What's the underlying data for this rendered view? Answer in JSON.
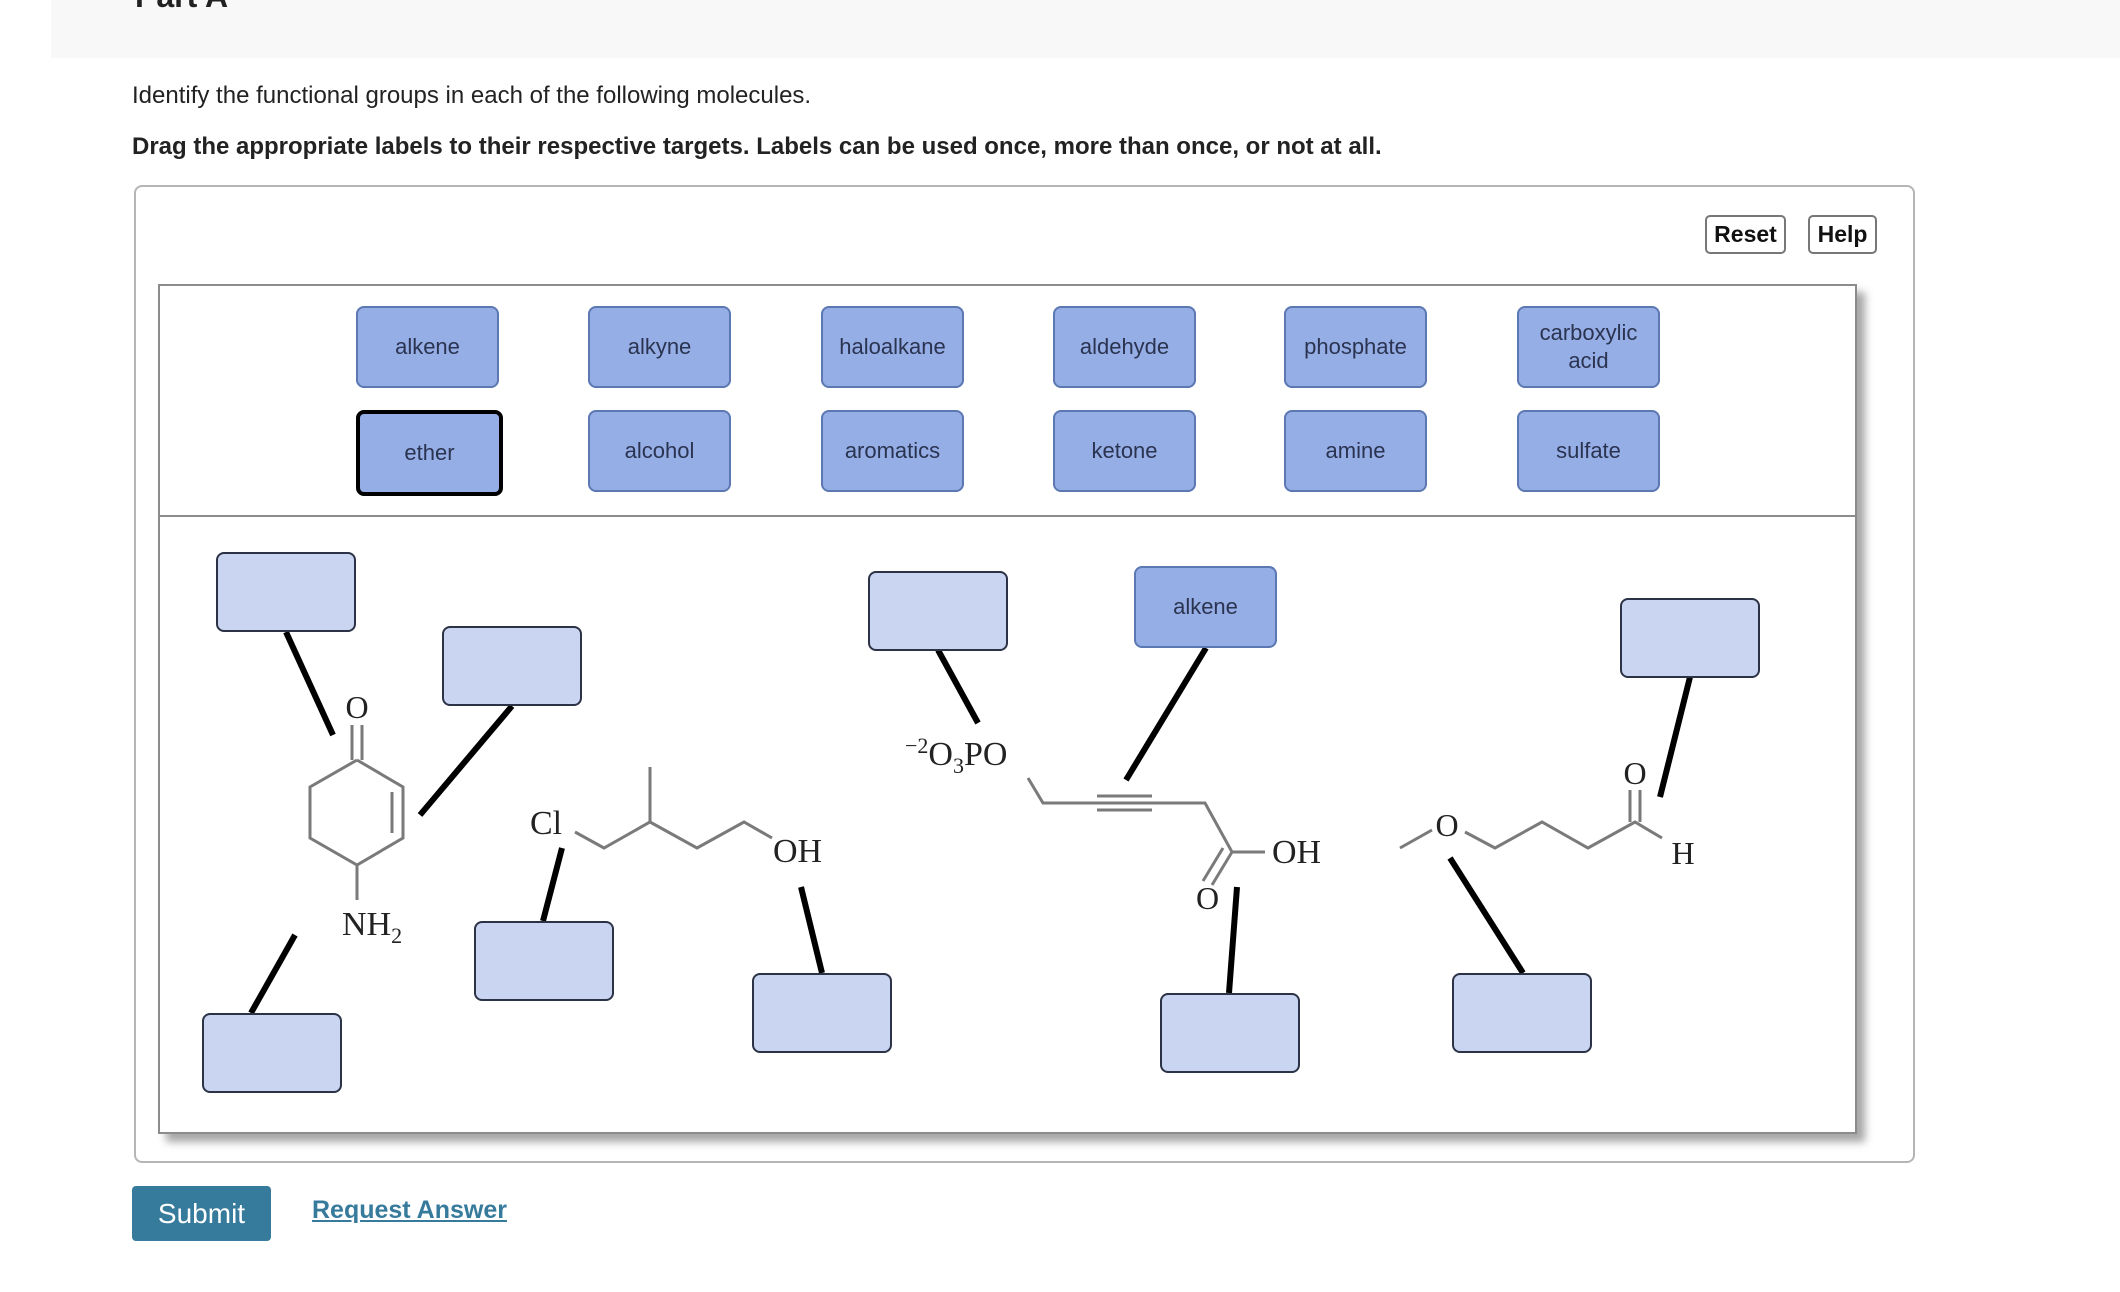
{
  "header": {
    "part_title": "Part A"
  },
  "instructions": {
    "prompt": "Identify the functional groups in each of the following molecules.",
    "directions": "Drag the appropriate labels to their respective targets. Labels can be used once, more than once, or not at all."
  },
  "toolbar": {
    "reset_label": "Reset",
    "help_label": "Help"
  },
  "label_bank": [
    {
      "label": "alkene",
      "selected": false
    },
    {
      "label": "alkyne",
      "selected": false
    },
    {
      "label": "haloalkane",
      "selected": false
    },
    {
      "label": "aldehyde",
      "selected": false
    },
    {
      "label": "phosphate",
      "selected": false
    },
    {
      "label": "carboxylic acid",
      "selected": false
    },
    {
      "label": "ether",
      "selected": true
    },
    {
      "label": "alcohol",
      "selected": false
    },
    {
      "label": "aromatics",
      "selected": false
    },
    {
      "label": "ketone",
      "selected": false
    },
    {
      "label": "amine",
      "selected": false
    },
    {
      "label": "sulfate",
      "selected": false
    }
  ],
  "molecules": {
    "cyclohexenone": {
      "oxygen": "O",
      "amine": "NH2"
    },
    "chloro_alcohol": {
      "halogen": "Cl",
      "hydroxyl": "OH"
    },
    "phosphate_acid": {
      "phosphate": "−2O3PO",
      "hydroxyl": "OH",
      "carbonyl_oxygen": "O"
    },
    "ether_aldehyde": {
      "ether_oxygen": "O",
      "carbonyl_oxygen": "O",
      "hydrogen": "H"
    }
  },
  "targets": [
    {
      "id": "ketone-carbonyl",
      "value": ""
    },
    {
      "id": "ring-double-bond",
      "value": ""
    },
    {
      "id": "amine-group",
      "value": ""
    },
    {
      "id": "chloro-group",
      "value": ""
    },
    {
      "id": "hydroxyl-group",
      "value": ""
    },
    {
      "id": "phosphate-group",
      "value": ""
    },
    {
      "id": "triple-bond",
      "value": "alkene"
    },
    {
      "id": "carboxyl-group",
      "value": ""
    },
    {
      "id": "aldehyde-group",
      "value": ""
    },
    {
      "id": "ether-group",
      "value": ""
    }
  ],
  "actions": {
    "submit_label": "Submit",
    "request_answer_label": "Request Answer"
  },
  "colors": {
    "tile_fill": "#96aee6",
    "target_fill": "#c9d5f1",
    "submit_fill": "#367a9c",
    "link": "#367a9c"
  }
}
